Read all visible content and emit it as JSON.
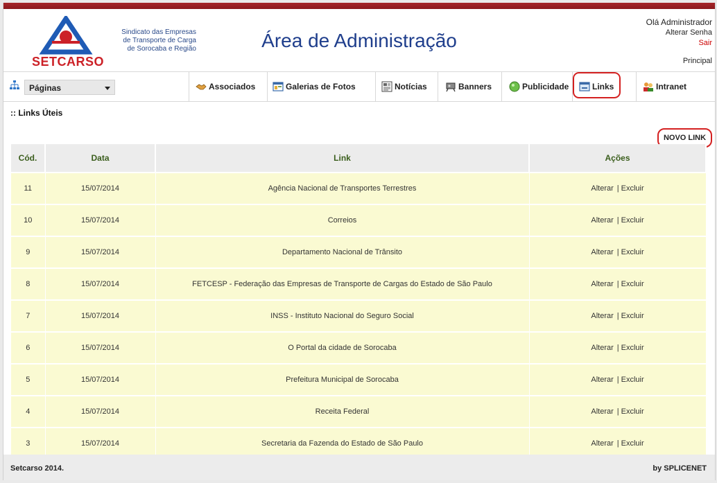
{
  "header": {
    "logo_text": "SETCARSO",
    "logo_tagline_1": "Sindicato das Empresas",
    "logo_tagline_2": "de Transporte de Carga",
    "logo_tagline_3": "de Sorocaba e Região",
    "title": "Área de Administração",
    "user_greeting": "Olá Administrador",
    "change_password": "Alterar Senha",
    "logout": "Sair",
    "home_link": "Principal"
  },
  "nav": {
    "pages_select": "Páginas",
    "items": [
      {
        "label": "Associados",
        "icon": "handshake-icon"
      },
      {
        "label": "Galerias de Fotos",
        "icon": "photo-gallery-icon"
      },
      {
        "label": "Notícias",
        "icon": "news-icon"
      },
      {
        "label": "Banners",
        "icon": "banner-icon"
      },
      {
        "label": "Publicidade",
        "icon": "green-circle-icon"
      },
      {
        "label": "Links",
        "icon": "links-icon"
      },
      {
        "label": "Intranet",
        "icon": "users-icon"
      }
    ]
  },
  "main": {
    "section_title": ":: Links Úteis",
    "new_button": "NOVO LINK",
    "columns": [
      "Cód.",
      "Data",
      "Link",
      "Ações"
    ],
    "action_edit": "Alterar",
    "action_delete": "Excluir",
    "action_sep": "|",
    "rows": [
      {
        "cod": "11",
        "data": "15/07/2014",
        "link": "Agência Nacional de Transportes Terrestres"
      },
      {
        "cod": "10",
        "data": "15/07/2014",
        "link": "Correios"
      },
      {
        "cod": "9",
        "data": "15/07/2014",
        "link": "Departamento Nacional de Trânsito"
      },
      {
        "cod": "8",
        "data": "15/07/2014",
        "link": "FETCESP - Federação das Empresas de Transporte de Cargas do Estado de São Paulo"
      },
      {
        "cod": "7",
        "data": "15/07/2014",
        "link": "INSS - Instituto Nacional do Seguro Social"
      },
      {
        "cod": "6",
        "data": "15/07/2014",
        "link": "O Portal da cidade de Sorocaba"
      },
      {
        "cod": "5",
        "data": "15/07/2014",
        "link": "Prefeitura Municipal de Sorocaba"
      },
      {
        "cod": "4",
        "data": "15/07/2014",
        "link": "Receita Federal"
      },
      {
        "cod": "3",
        "data": "15/07/2014",
        "link": "Secretaria da Fazenda do Estado de São Paulo"
      }
    ]
  },
  "footer": {
    "left": "Setcarso 2014.",
    "right": "by SPLICENET"
  },
  "colors": {
    "brand_red": "#a5262a",
    "brand_blue": "#1f3e8c",
    "row_bg": "#fafad2",
    "header_text_green": "#3b5e1d",
    "highlight_red": "#d42020"
  }
}
